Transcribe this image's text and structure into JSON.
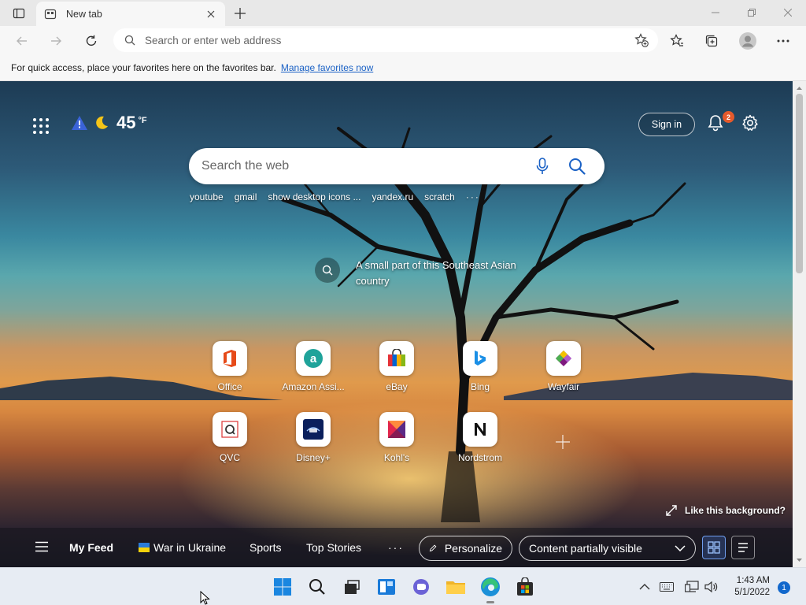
{
  "browser": {
    "tab": {
      "title": "New tab"
    },
    "address_bar": {
      "placeholder": "Search or enter web address"
    },
    "favorites_bar": {
      "message": "For quick access, place your favorites here on the favorites bar.",
      "link": "Manage favorites now"
    }
  },
  "newtab": {
    "weather": {
      "temperature": "45",
      "unit": "°F"
    },
    "sign_in": "Sign in",
    "notifications": {
      "count": "2"
    },
    "search": {
      "placeholder": "Search the web"
    },
    "quick_links": [
      "youtube",
      "gmail",
      "show desktop icons ...",
      "yandex.ru",
      "scratch"
    ],
    "quick_links_more": "···",
    "image_caption": "A small part of this Southeast Asian country",
    "tiles": [
      {
        "label": "Office",
        "icon": "office-icon"
      },
      {
        "label": "Amazon Assi...",
        "icon": "amazon-icon"
      },
      {
        "label": "eBay",
        "icon": "ebay-icon"
      },
      {
        "label": "Bing",
        "icon": "bing-icon"
      },
      {
        "label": "Wayfair",
        "icon": "wayfair-icon"
      },
      {
        "label": "QVC",
        "icon": "qvc-icon"
      },
      {
        "label": "Disney+",
        "icon": "disney-icon"
      },
      {
        "label": "Kohl's",
        "icon": "kohls-icon"
      },
      {
        "label": "Nordstrom",
        "icon": "nordstrom-icon"
      }
    ],
    "like_background": "Like this background?",
    "feed": {
      "items": [
        "My Feed",
        "War in Ukraine",
        "Sports",
        "Top Stories"
      ],
      "more": "···",
      "personalize": "Personalize",
      "content_visibility": "Content partially visible"
    }
  },
  "taskbar": {
    "time": "1:43 AM",
    "date": "5/1/2022",
    "notification_count": "1"
  },
  "colors": {
    "accent": "#1a61c5",
    "taskbar": "#e7ecf3",
    "badge": "#e65a2c"
  }
}
